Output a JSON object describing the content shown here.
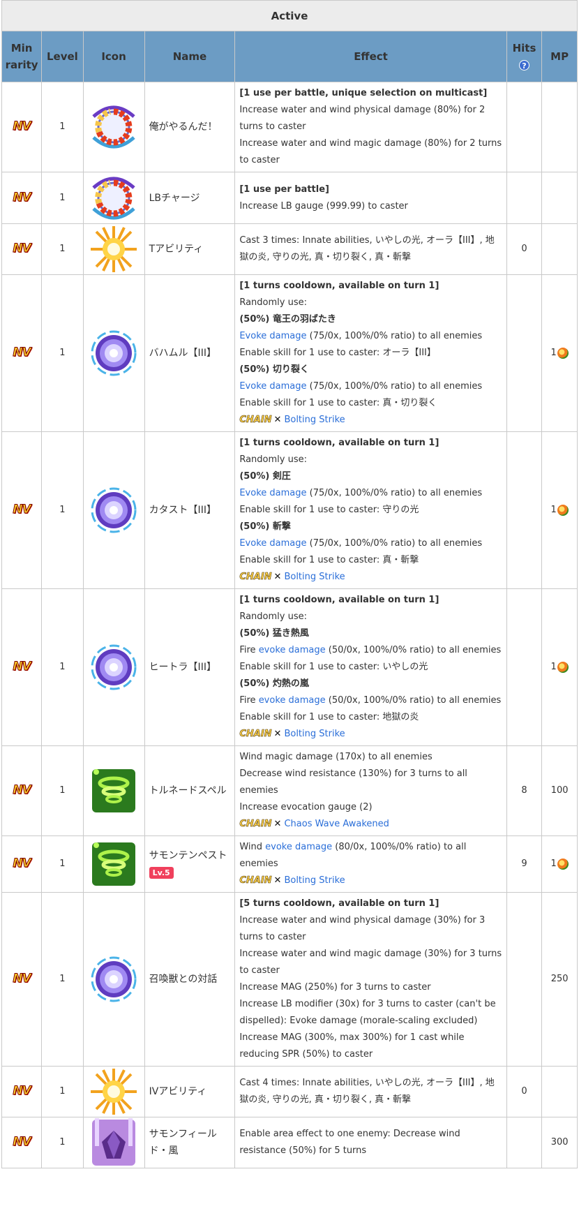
{
  "caption": "Active",
  "columns": {
    "rarity": "Min rarity",
    "level": "Level",
    "icon": "Icon",
    "name": "Name",
    "effect": "Effect",
    "hits": "Hits",
    "mp": "MP"
  },
  "help_icon": "?",
  "rarity_text": "NV",
  "chain_label": "CHAIN",
  "chain_cross": "✕",
  "rows": [
    {
      "level": "1",
      "icon": "limit-gauge-icon",
      "name": "俺がやるんだ！",
      "hits": "",
      "mp": "",
      "mp_orb": false,
      "effect": [
        {
          "b": "[1 use per battle, unique selection on multicast]"
        },
        {
          "t": "Increase water and wind physical damage (80%) for 2 turns to caster"
        },
        {
          "t": "Increase water and wind magic damage (80%) for 2 turns to caster"
        }
      ]
    },
    {
      "level": "1",
      "icon": "limit-gauge-icon",
      "name": "LBチャージ",
      "hits": "",
      "mp": "",
      "mp_orb": false,
      "effect": [
        {
          "b": "[1 use per battle]"
        },
        {
          "t": "Increase LB gauge (999.99) to caster"
        }
      ]
    },
    {
      "level": "1",
      "icon": "burst-icon",
      "name": "Tアビリティ",
      "hits": "0",
      "mp": "",
      "mp_orb": false,
      "effect": [
        {
          "t": "Cast 3 times: Innate abilities, いやしの光, オーラ【III】, 地獄の炎, 守りの光, 真・切り裂く, 真・斬撃"
        }
      ]
    },
    {
      "level": "1",
      "icon": "vortex-icon",
      "name": "バハムル【III】",
      "hits": "",
      "mp": "1",
      "mp_orb": true,
      "effect": [
        {
          "b": "[1 turns cooldown, available on turn 1]"
        },
        {
          "t": "Randomly use:"
        },
        {
          "b": "(50%) 竜王の羽ばたき"
        },
        {
          "l": "Evoke damage",
          "t": " (75/0x, 100%/0% ratio) to all enemies"
        },
        {
          "t": "Enable skill for 1 use to caster: オーラ【III】"
        },
        {
          "b": "(50%) 切り裂く"
        },
        {
          "l": "Evoke damage",
          "t": " (75/0x, 100%/0% ratio) to all enemies"
        },
        {
          "t": "Enable skill for 1 use to caster: 真・切り裂く"
        },
        {
          "chain": "Bolting Strike"
        }
      ]
    },
    {
      "level": "1",
      "icon": "vortex-icon",
      "name": "カタスト【III】",
      "hits": "",
      "mp": "1",
      "mp_orb": true,
      "effect": [
        {
          "b": "[1 turns cooldown, available on turn 1]"
        },
        {
          "t": "Randomly use:"
        },
        {
          "b": "(50%) 剣圧"
        },
        {
          "l": "Evoke damage",
          "t": " (75/0x, 100%/0% ratio) to all enemies"
        },
        {
          "t": "Enable skill for 1 use to caster: 守りの光"
        },
        {
          "b": "(50%) 斬撃"
        },
        {
          "l": "Evoke damage",
          "t": " (75/0x, 100%/0% ratio) to all enemies"
        },
        {
          "t": "Enable skill for 1 use to caster: 真・斬撃"
        },
        {
          "chain": "Bolting Strike"
        }
      ]
    },
    {
      "level": "1",
      "icon": "vortex-icon",
      "name": "ヒートラ【III】",
      "hits": "",
      "mp": "1",
      "mp_orb": true,
      "effect": [
        {
          "b": "[1 turns cooldown, available on turn 1]"
        },
        {
          "t": "Randomly use:"
        },
        {
          "b": "(50%) 猛き熱風"
        },
        {
          "p": "Fire ",
          "l": "evoke damage",
          "t": " (50/0x, 100%/0% ratio) to all enemies"
        },
        {
          "t": "Enable skill for 1 use to caster: いやしの光"
        },
        {
          "b": "(50%) 灼熱の嵐"
        },
        {
          "p": "Fire ",
          "l": "evoke damage",
          "t": " (50/0x, 100%/0% ratio) to all enemies"
        },
        {
          "t": "Enable skill for 1 use to caster: 地獄の炎"
        },
        {
          "chain": "Bolting Strike"
        }
      ]
    },
    {
      "level": "1",
      "icon": "green-tornado-icon",
      "name": "トルネードスペル",
      "hits": "8",
      "mp": "100",
      "mp_orb": false,
      "effect": [
        {
          "t": "Wind magic damage (170x) to all enemies"
        },
        {
          "t": "Decrease wind resistance (130%) for 3 turns to all enemies"
        },
        {
          "t": "Increase evocation gauge (2)"
        },
        {
          "chain": "Chaos Wave Awakened"
        }
      ]
    },
    {
      "level": "1",
      "icon": "green-tornado-icon",
      "name": "サモンテンペスト",
      "badge": "Lv.5",
      "hits": "9",
      "mp": "1",
      "mp_orb": true,
      "effect": [
        {
          "p": "Wind ",
          "l": "evoke damage",
          "t": " (80/0x, 100%/0% ratio) to all enemies"
        },
        {
          "chain": "Bolting Strike"
        }
      ]
    },
    {
      "level": "1",
      "icon": "vortex-icon",
      "name": "召喚獣との対話",
      "hits": "",
      "mp": "250",
      "mp_orb": false,
      "effect": [
        {
          "b": "[5 turns cooldown, available on turn 1]"
        },
        {
          "t": "Increase water and wind physical damage (30%) for 3 turns to caster"
        },
        {
          "t": "Increase water and wind magic damage (30%) for 3 turns to caster"
        },
        {
          "t": "Increase MAG (250%) for 3 turns to caster"
        },
        {
          "t": "Increase LB modifier (30x) for 3 turns to caster (can't be dispelled): Evoke damage (morale-scaling excluded)"
        },
        {
          "t": "Increase MAG (300%, max 300%) for 1 cast while reducing SPR (50%) to caster"
        }
      ]
    },
    {
      "level": "1",
      "icon": "burst-icon",
      "name": "IVアビリティ",
      "hits": "0",
      "mp": "",
      "mp_orb": false,
      "effect": [
        {
          "t": "Cast 4 times: Innate abilities, いやしの光, オーラ【III】, 地獄の炎, 守りの光, 真・切り裂く, 真・斬撃"
        }
      ]
    },
    {
      "level": "1",
      "icon": "purple-crystal-icon",
      "name": "サモンフィールド・風",
      "hits": "",
      "mp": "300",
      "mp_orb": false,
      "effect": [
        {
          "t": "Enable area effect to one enemy: Decrease wind resistance (50%) for 5 turns"
        }
      ]
    }
  ]
}
